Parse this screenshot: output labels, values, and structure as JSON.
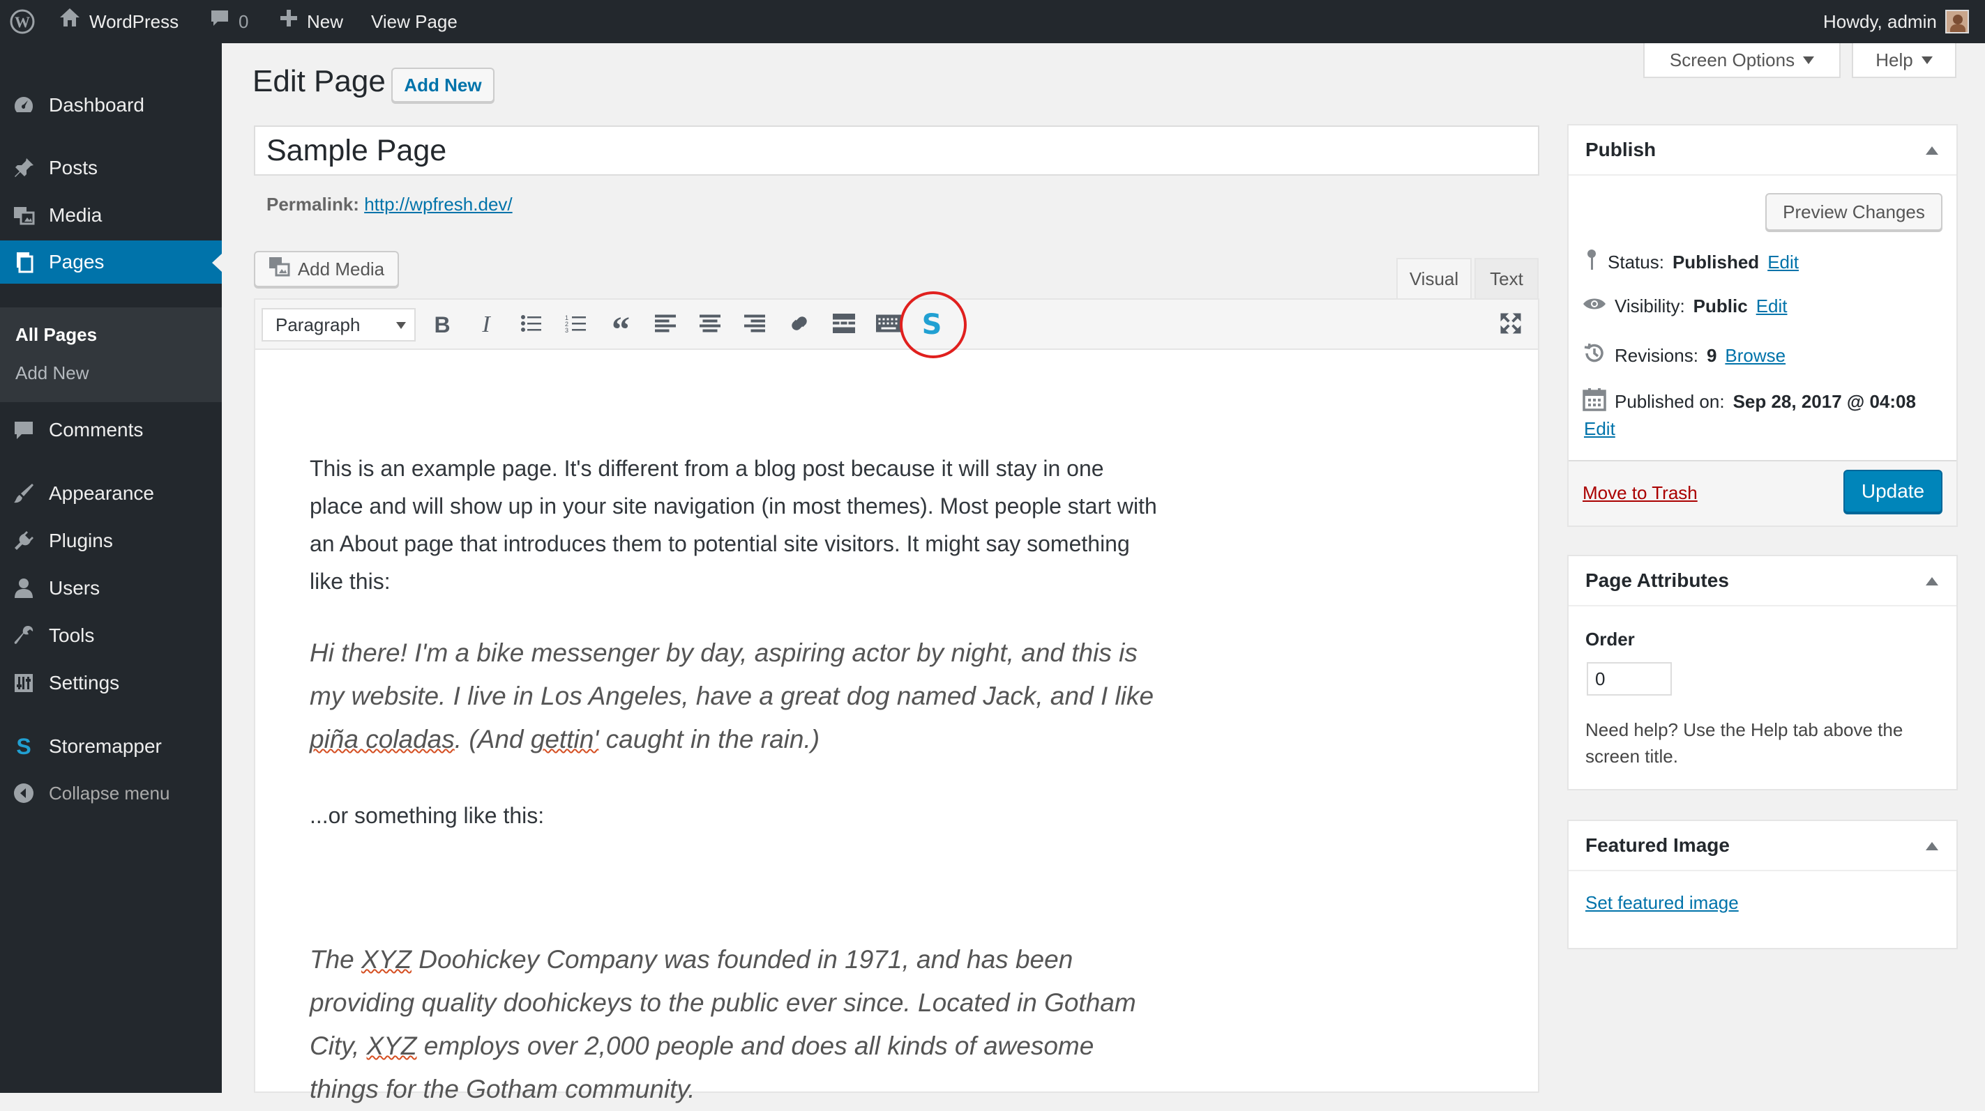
{
  "adminbar": {
    "site_name": "WordPress",
    "comments_count": "0",
    "new_label": "New",
    "view_page_label": "View Page",
    "howdy": "Howdy, admin"
  },
  "sidebar": {
    "items": [
      {
        "label": "Dashboard",
        "icon": "dashboard-icon"
      },
      {
        "label": "Posts",
        "icon": "pin-icon"
      },
      {
        "label": "Media",
        "icon": "media-icon"
      },
      {
        "label": "Pages",
        "icon": "pages-icon"
      },
      {
        "label": "Comments",
        "icon": "comment-icon"
      },
      {
        "label": "Appearance",
        "icon": "brush-icon"
      },
      {
        "label": "Plugins",
        "icon": "plugin-icon"
      },
      {
        "label": "Users",
        "icon": "user-icon"
      },
      {
        "label": "Tools",
        "icon": "wrench-icon"
      },
      {
        "label": "Settings",
        "icon": "settings-icon"
      },
      {
        "label": "Storemapper",
        "icon": "storemapper-icon"
      },
      {
        "label": "Collapse menu",
        "icon": "collapse-icon"
      }
    ],
    "submenu": [
      "All Pages",
      "Add New"
    ]
  },
  "header": {
    "title": "Edit Page",
    "add_new": "Add New",
    "screen_options": "Screen Options",
    "help": "Help"
  },
  "editor": {
    "post_title": "Sample Page",
    "permalink_label": "Permalink:",
    "permalink_url": "http://wpfresh.dev/",
    "add_media": "Add Media",
    "tab_visual": "Visual",
    "tab_text": "Text",
    "format_select": "Paragraph",
    "para1": "This is an example page. It's different from a blog post because it will stay in one place and will show up in your site navigation (in most themes). Most people start with an About page that introduces them to potential site visitors. It might say something like this:",
    "quote1_a": "Hi there! I'm a bike messenger by day, aspiring actor by night, and this is my website. I live in Los Angeles, have a great dog named Jack, and I like ",
    "quote1_b": "piña coladas",
    "quote1_c": ". (And ",
    "quote1_d": "gettin'",
    "quote1_e": " caught in the rain.)",
    "para2": "...or something like this:",
    "quote2_a": "The ",
    "quote2_b": "XYZ",
    "quote2_c": " Doohickey Company was founded in 1971, and has been providing quality doohickeys to the public ever since. Located in Gotham City, ",
    "quote2_d": "XYZ",
    "quote2_e": " employs over 2,000 people and does all kinds of awesome things for the Gotham community."
  },
  "publish": {
    "title": "Publish",
    "preview": "Preview Changes",
    "status_label": "Status:",
    "status_value": "Published",
    "visibility_label": "Visibility:",
    "visibility_value": "Public",
    "revisions_label": "Revisions:",
    "revisions_value": "9",
    "browse": "Browse",
    "published_on_label": "Published on:",
    "published_on_value": "Sep 28, 2017 @ 04:08",
    "edit": "Edit",
    "trash": "Move to Trash",
    "update": "Update"
  },
  "page_attributes": {
    "title": "Page Attributes",
    "order_label": "Order",
    "order_value": "0",
    "help_text": "Need help? Use the Help tab above the screen title."
  },
  "featured_image": {
    "title": "Featured Image",
    "set_link": "Set featured image"
  },
  "colors": {
    "accent": "#0073aa",
    "storemapper": "#21a0d2",
    "highlight_circle": "#e0201e",
    "trash": "#a00"
  }
}
